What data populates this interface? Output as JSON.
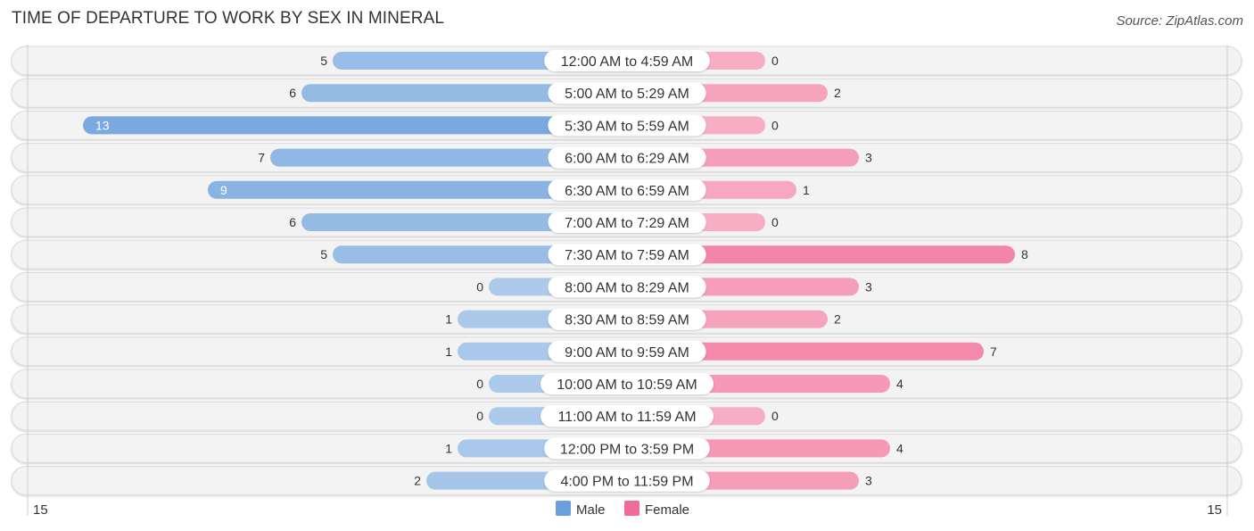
{
  "title": "TIME OF DEPARTURE TO WORK BY SEX IN MINERAL",
  "source": "Source: ZipAtlas.com",
  "chart_data": {
    "type": "bar",
    "orientation": "horizontal-diverging",
    "title": "TIME OF DEPARTURE TO WORK BY SEX IN MINERAL",
    "categories": [
      "12:00 AM to 4:59 AM",
      "5:00 AM to 5:29 AM",
      "5:30 AM to 5:59 AM",
      "6:00 AM to 6:29 AM",
      "6:30 AM to 6:59 AM",
      "7:00 AM to 7:29 AM",
      "7:30 AM to 7:59 AM",
      "8:00 AM to 8:29 AM",
      "8:30 AM to 8:59 AM",
      "9:00 AM to 9:59 AM",
      "10:00 AM to 10:59 AM",
      "11:00 AM to 11:59 AM",
      "12:00 PM to 3:59 PM",
      "4:00 PM to 11:59 PM"
    ],
    "series": [
      {
        "name": "Male",
        "color": "#6a9fdb",
        "values": [
          5,
          6,
          13,
          7,
          9,
          6,
          5,
          0,
          1,
          1,
          0,
          0,
          1,
          2
        ]
      },
      {
        "name": "Female",
        "color": "#f06b96",
        "values": [
          0,
          2,
          0,
          3,
          1,
          0,
          8,
          3,
          2,
          7,
          4,
          0,
          4,
          3
        ]
      }
    ],
    "axis": {
      "min_label": "15",
      "max_label": "15",
      "range": [
        0,
        15
      ]
    },
    "legend": {
      "position": "bottom-center",
      "items": [
        "Male",
        "Female"
      ]
    },
    "grid": false
  }
}
